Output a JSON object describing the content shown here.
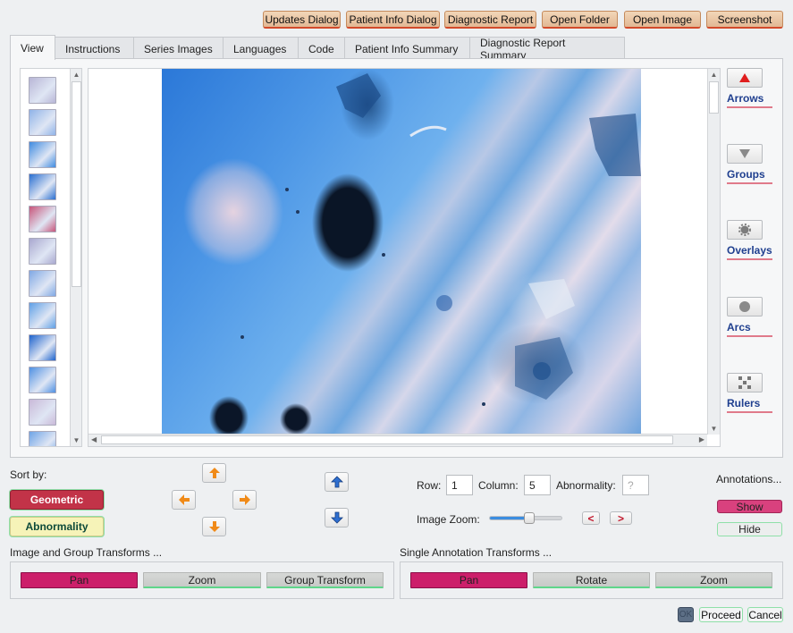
{
  "toolbar": {
    "updates_dialog": "Updates Dialog",
    "patient_info_dialog": "Patient Info Dialog",
    "diagnostic_report": "Diagnostic Report",
    "open_folder": "Open Folder",
    "open_image": "Open Image",
    "screenshot": "Screenshot"
  },
  "tabs": [
    {
      "label": "View"
    },
    {
      "label": "Instructions"
    },
    {
      "label": "Series Images"
    },
    {
      "label": "Languages"
    },
    {
      "label": "Code"
    },
    {
      "label": "Patient Info Summary"
    },
    {
      "label": "Diagnostic Report Summary"
    }
  ],
  "thumbnails": {
    "colors": [
      "#b8b6d6",
      "#8fb3e8",
      "#3f8be0",
      "#2a6fd0",
      "#c7557a",
      "#a9a8cf",
      "#7fa8e4",
      "#5fa0e6",
      "#1e63cc",
      "#4f90e2",
      "#c9b9d8",
      "#6ea4e6"
    ]
  },
  "tools": {
    "arrows": "Arrows",
    "groups": "Groups",
    "overlays": "Overlays",
    "arcs": "Arcs",
    "rulers": "Rulers"
  },
  "sort": {
    "label": "Sort by:",
    "geometric": "Geometric",
    "abnormality": "Abnormality"
  },
  "grid": {
    "row_label": "Row:",
    "row_value": "1",
    "column_label": "Column:",
    "column_value": "5",
    "abnormality_label": "Abnormality:",
    "abnormality_placeholder": "?",
    "zoom_label": "Image Zoom:",
    "zoom_level": 0.55,
    "zoom_out": "<",
    "zoom_in": ">"
  },
  "annotations": {
    "label": "Annotations...",
    "show": "Show",
    "hide": "Hide"
  },
  "image_transforms": {
    "title": "Image and Group Transforms ...",
    "pan": "Pan",
    "zoom": "Zoom",
    "group_transform": "Group Transform"
  },
  "single_transforms": {
    "title": "Single Annotation Transforms ...",
    "pan": "Pan",
    "rotate": "Rotate",
    "zoom": "Zoom"
  },
  "footer": {
    "ok": "OK",
    "proceed": "Proceed",
    "cancel": "Cancel"
  }
}
